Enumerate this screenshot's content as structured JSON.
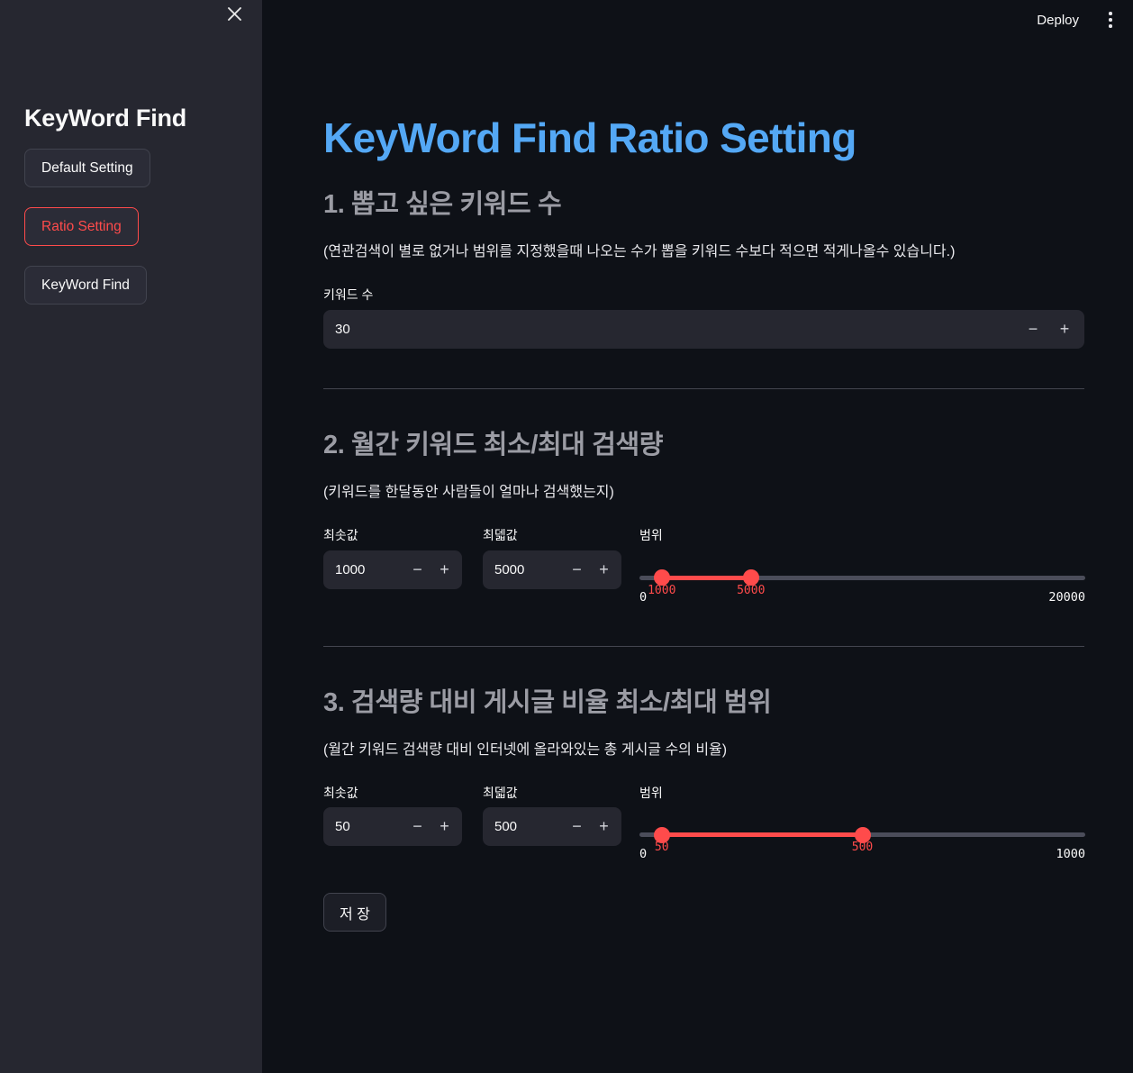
{
  "topbar": {
    "deploy_label": "Deploy",
    "menu_icon": "more-vertical-icon"
  },
  "sidebar": {
    "close_icon": "close-icon",
    "title": "KeyWord Find",
    "items": [
      {
        "label": "Default Setting",
        "active": false
      },
      {
        "label": "Ratio Setting",
        "active": true
      },
      {
        "label": "KeyWord Find",
        "active": false
      }
    ]
  },
  "main": {
    "page_title": "KeyWord Find Ratio Setting",
    "sections": [
      {
        "heading": "1. 뽑고 싶은 키워드 수",
        "description": "(연관검색이 별로 없거나 범위를 지정했을때 나오는 수가 뽑을 키워드 수보다 적으면 적게나올수 있습니다.)",
        "field_label": "키워드 수",
        "value": "30",
        "minus_label": "−",
        "plus_label": "+"
      },
      {
        "heading": "2. 월간 키워드 최소/최대 검색량",
        "description": "(키워드를 한달동안 사람들이 얼마나 검색했는지)",
        "min_label": "최솟값",
        "max_label": "최덻값",
        "range_label": "범위",
        "min_value": "1000",
        "max_value": "5000",
        "slider_min_thumb": "1000",
        "slider_max_thumb": "5000",
        "slider_lo": "0",
        "slider_hi": "20000",
        "minus_label": "−",
        "plus_label": "+"
      },
      {
        "heading": "3. 검색량 대비 게시글 비율 최소/최대 범위",
        "description": "(월간 키워드 검색량 대비 인터넷에 올라와있는 총 게시글 수의 비율)",
        "min_label": "최솟값",
        "max_label": "최덻값",
        "range_label": "범위",
        "min_value": "50",
        "max_value": "500",
        "slider_min_thumb": "50",
        "slider_max_thumb": "500",
        "slider_lo": "0",
        "slider_hi": "1000",
        "minus_label": "−",
        "plus_label": "+"
      }
    ],
    "save_label": "저 장"
  },
  "colors": {
    "accent_blue": "#54a8f5",
    "accent_red": "#ff4b4b",
    "sidebar_bg": "#262730",
    "main_bg": "#0e1117",
    "heading_gray": "#9b9ca4"
  },
  "slider_geometry": {
    "section2_min_pct": 5,
    "section2_max_pct": 25,
    "section3_min_pct": 5,
    "section3_max_pct": 50
  }
}
